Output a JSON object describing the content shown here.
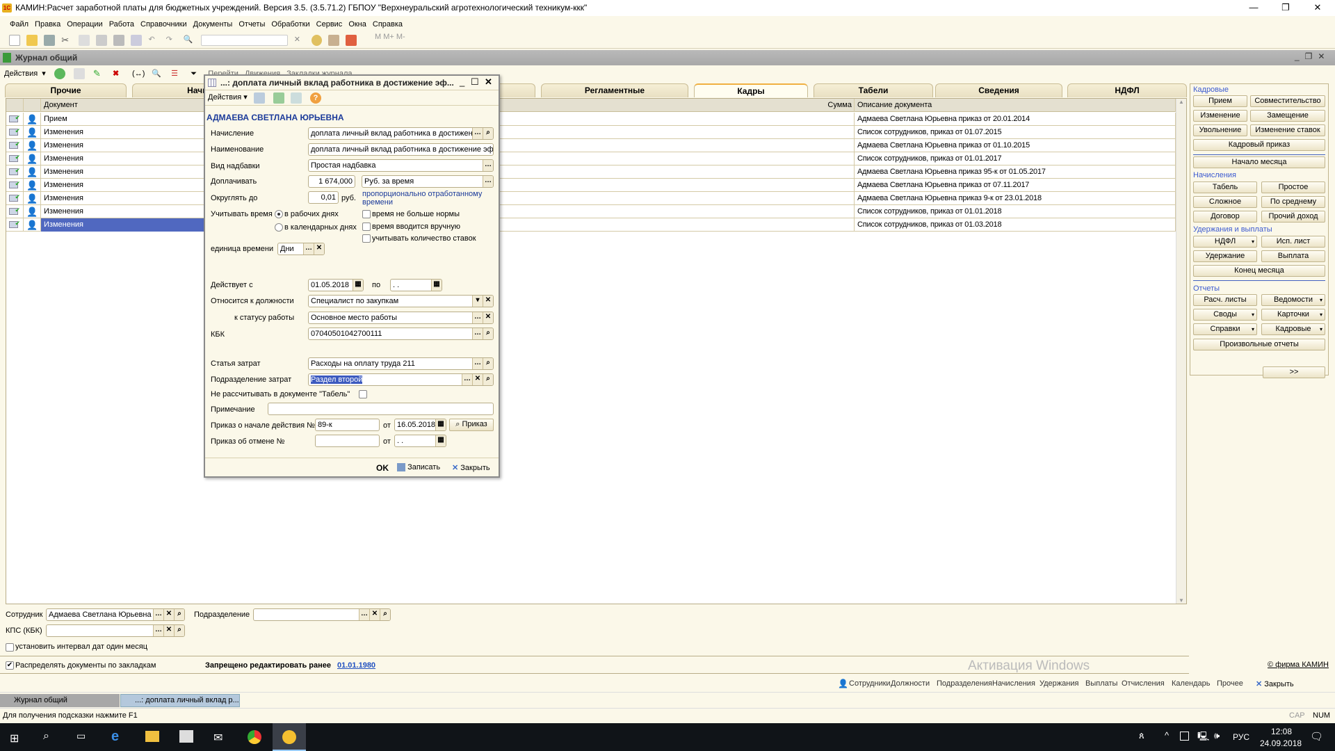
{
  "app": {
    "title": "КАМИН:Расчет заработной платы для бюджетных учреждений. Версия 3.5. (3.5.71.2) ГБПОУ \"Верхнеуральский агротехнологический техникум-ккк\"",
    "logo": "1С",
    "menu": [
      "Файл",
      "Правка",
      "Операции",
      "Работа",
      "Справочники",
      "Документы",
      "Отчеты",
      "Обработки",
      "Сервис",
      "Окна",
      "Справка"
    ],
    "toolbar_labels": [
      "M",
      "M+",
      "M-"
    ]
  },
  "journal": {
    "title": "Журнал общий",
    "toolbar": {
      "actions": "Действия",
      "goto": "Перейти",
      "movements": "Движения",
      "bookmarks": "Закладки журнала"
    },
    "tabs": [
      "Прочие",
      "Начисления",
      "",
      "",
      "Регламентные",
      "Кадры",
      "Табели",
      "Сведения",
      "НДФЛ"
    ],
    "active_tab": "Кадры",
    "columns": {
      "document": "Документ",
      "sum": "Сумма",
      "description": "Описание документа"
    },
    "rows": [
      {
        "doc": "Прием",
        "desc": "Адмаева Светлана Юрьевна приказ  от 20.01.2014"
      },
      {
        "doc": "Изменения",
        "desc": "Список сотрудников, приказ  от 01.07.2015"
      },
      {
        "doc": "Изменения",
        "desc": "Адмаева Светлана Юрьевна приказ  от 01.10.2015"
      },
      {
        "doc": "Изменения",
        "desc": "Список сотрудников, приказ  от 01.01.2017"
      },
      {
        "doc": "Изменения",
        "desc": "Адмаева Светлана Юрьевна приказ 95-к от 01.05.2017"
      },
      {
        "doc": "Изменения",
        "desc": "Адмаева Светлана Юрьевна приказ  от 07.11.2017"
      },
      {
        "doc": "Изменения",
        "desc": "Адмаева Светлана Юрьевна приказ 9-к от 23.01.2018"
      },
      {
        "doc": "Изменения",
        "desc": "Список сотрудников, приказ  от 01.01.2018"
      },
      {
        "doc": "Изменения",
        "desc": "Список сотрудников, приказ  от 01.03.2018",
        "selected": true
      }
    ],
    "filters": {
      "employee_label": "Сотрудник",
      "employee_value": "Адмаева Светлана Юрьевна",
      "department_label": "Подразделение",
      "department_value": "",
      "kps_label": "КПС (КБК)",
      "kps_value": "",
      "interval_label": "установить интервал дат один месяц",
      "interval_checked": false
    },
    "distribute_label": "Распределять документы по закладкам",
    "distribute_checked": true,
    "forbidden_label": "Запрещено редактировать ранее",
    "forbidden_date": "01.01.1980"
  },
  "dialog": {
    "title": "...: доплата личный вклад работника в достижение эф...",
    "actions": "Действия",
    "employee": "АДМАЕВА СВЕТЛАНА ЮРЬЕВНА",
    "accrual_label": "Начисление",
    "accrual": "доплата личный вклад работника в достижение эффективности",
    "name_label": "Наименование",
    "name": "доплата личный вклад работника в достижение эффективности",
    "kind_label": "Вид надбавки",
    "kind": "Простая надбавка",
    "pay_label": "Доплачивать",
    "pay_amount": "1 674,000",
    "pay_unit": "Руб. за время",
    "round_label": "Округлять до",
    "round": "0,01",
    "round_unit": "руб.",
    "proportional": "пропорционально отработанному времени",
    "time_label": "Учитывать время",
    "radio_work": "в рабочих днях",
    "radio_cal": "в календарных днях",
    "radio_selected": "в рабочих днях",
    "cb_norm": "время не больше нормы",
    "cb_manual": "время вводится вручную",
    "cb_rates": "учитывать количество ставок",
    "unit_label": "единица времени",
    "unit": "Дни",
    "from_label": "Действует с",
    "from": "01.05.2018",
    "to_label": "по",
    "to": " .  .",
    "position_label": "Относится к должности",
    "position": "Специалист по закупкам",
    "status_label": "к статусу работы",
    "status": "Основное место работы",
    "kbk_label": "КБК",
    "kbk": "07040501042700111",
    "cost_label": "Статья затрат",
    "cost": "Расходы на оплату труда 211",
    "dept_label": "Подразделение затрат",
    "dept": "Раздел второй",
    "no_tabel_label": "Не рассчитывать в документе \"Табель\"",
    "note_label": "Примечание",
    "note": "",
    "order_start_label": "Приказ о начале действия №",
    "order_start": "89-к",
    "order_from": "от",
    "order_start_date": "16.05.2018",
    "order_btn": "Приказ",
    "order_cancel_label": "Приказ об отмене №",
    "order_cancel": "",
    "order_cancel_date": " .  .",
    "ok": "OK",
    "save": "Записать",
    "close": "Закрыть"
  },
  "panel": {
    "g1": "Кадровые",
    "g1_buttons": [
      "Прием",
      "Совместительство",
      "Изменение",
      "Замещение",
      "Увольнение",
      "Изменение ставок"
    ],
    "hr_order": "Кадровый приказ",
    "month_start": "Начало месяца",
    "g2": "Начисления",
    "g2_buttons": [
      "Табель",
      "Простое",
      "Сложное",
      "По среднему",
      "Договор",
      "Прочий доход"
    ],
    "g3": "Удержания и выплаты",
    "g3_buttons": [
      "НДФЛ",
      "Исп. лист",
      "Удержание",
      "Выплата"
    ],
    "month_end": "Конец месяца",
    "g4": "Отчеты",
    "g4_buttons": [
      "Расч. листы",
      "Ведомости",
      "Своды",
      "Карточки",
      "Справки",
      "Кадровые"
    ],
    "custom": "Произвольные отчеты",
    "more": ">>"
  },
  "bottom": {
    "activation": "Активация Windows",
    "firm": "© фирма КАМИН",
    "links": [
      "Сотрудники",
      "Должности",
      "Подразделения",
      "Начисления",
      "Удержания",
      "Выплаты",
      "Отчисления",
      "Календарь",
      "Прочее"
    ],
    "close": "Закрыть"
  },
  "windows": [
    "Журнал общий",
    "...: доплата личный вклад р..."
  ],
  "status": {
    "hint": "Для получения подсказки нажмите F1",
    "cap": "CAP",
    "num": "NUM"
  },
  "taskbar": {
    "lang": "РУС",
    "time": "12:08",
    "date": "24.09.2018"
  }
}
